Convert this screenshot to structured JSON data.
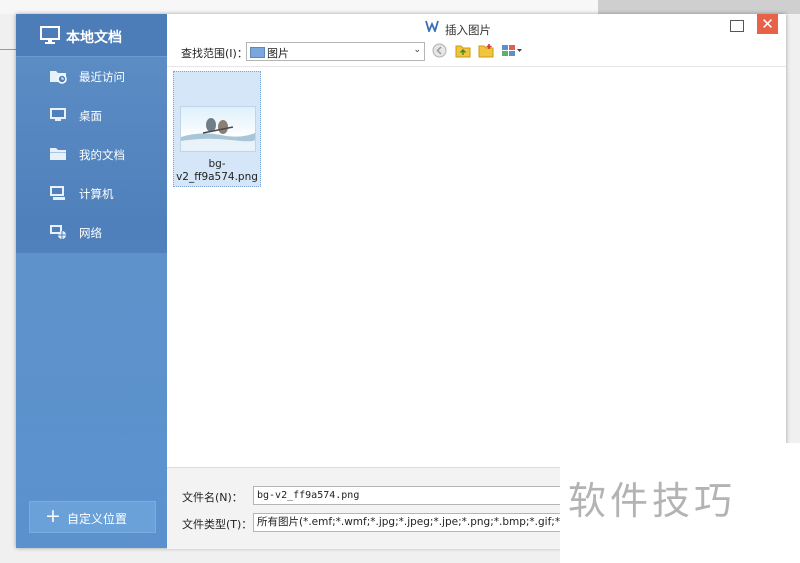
{
  "window": {
    "title": "插入图片",
    "close_glyph": "✕"
  },
  "sidebar": {
    "title": "本地文档",
    "items": [
      {
        "label": "最近访问",
        "icon": "recent-folder-icon"
      },
      {
        "label": "桌面",
        "icon": "desktop-icon"
      },
      {
        "label": "我的文档",
        "icon": "folder-icon"
      },
      {
        "label": "计算机",
        "icon": "computer-icon"
      },
      {
        "label": "网络",
        "icon": "network-icon"
      }
    ],
    "custom_location": {
      "label": "自定义位置",
      "icon_glyph": "+"
    }
  },
  "toolbar": {
    "look_in_label": "查找范围(I)：",
    "look_in_value": "图片",
    "dropdown_glyph": "⌄"
  },
  "files": [
    {
      "name": "bg-v2_ff9a574.png",
      "selected": true
    }
  ],
  "footer": {
    "filename_label": "文件名(N)：",
    "filename_value": "bg-v2_ff9a574.png",
    "filetype_label": "文件类型(T)：",
    "filetype_value": "所有图片(*.emf;*.wmf;*.jpg;*.jpeg;*.jpe;*.png;*.bmp;*.gif;*.tif;*.tiff;*.w"
  },
  "watermark": "软件技巧",
  "colors": {
    "sidebar": "#4f80bb",
    "accent": "#3a6fb7",
    "close": "#e8624a",
    "selection": "#d4e6f8"
  }
}
